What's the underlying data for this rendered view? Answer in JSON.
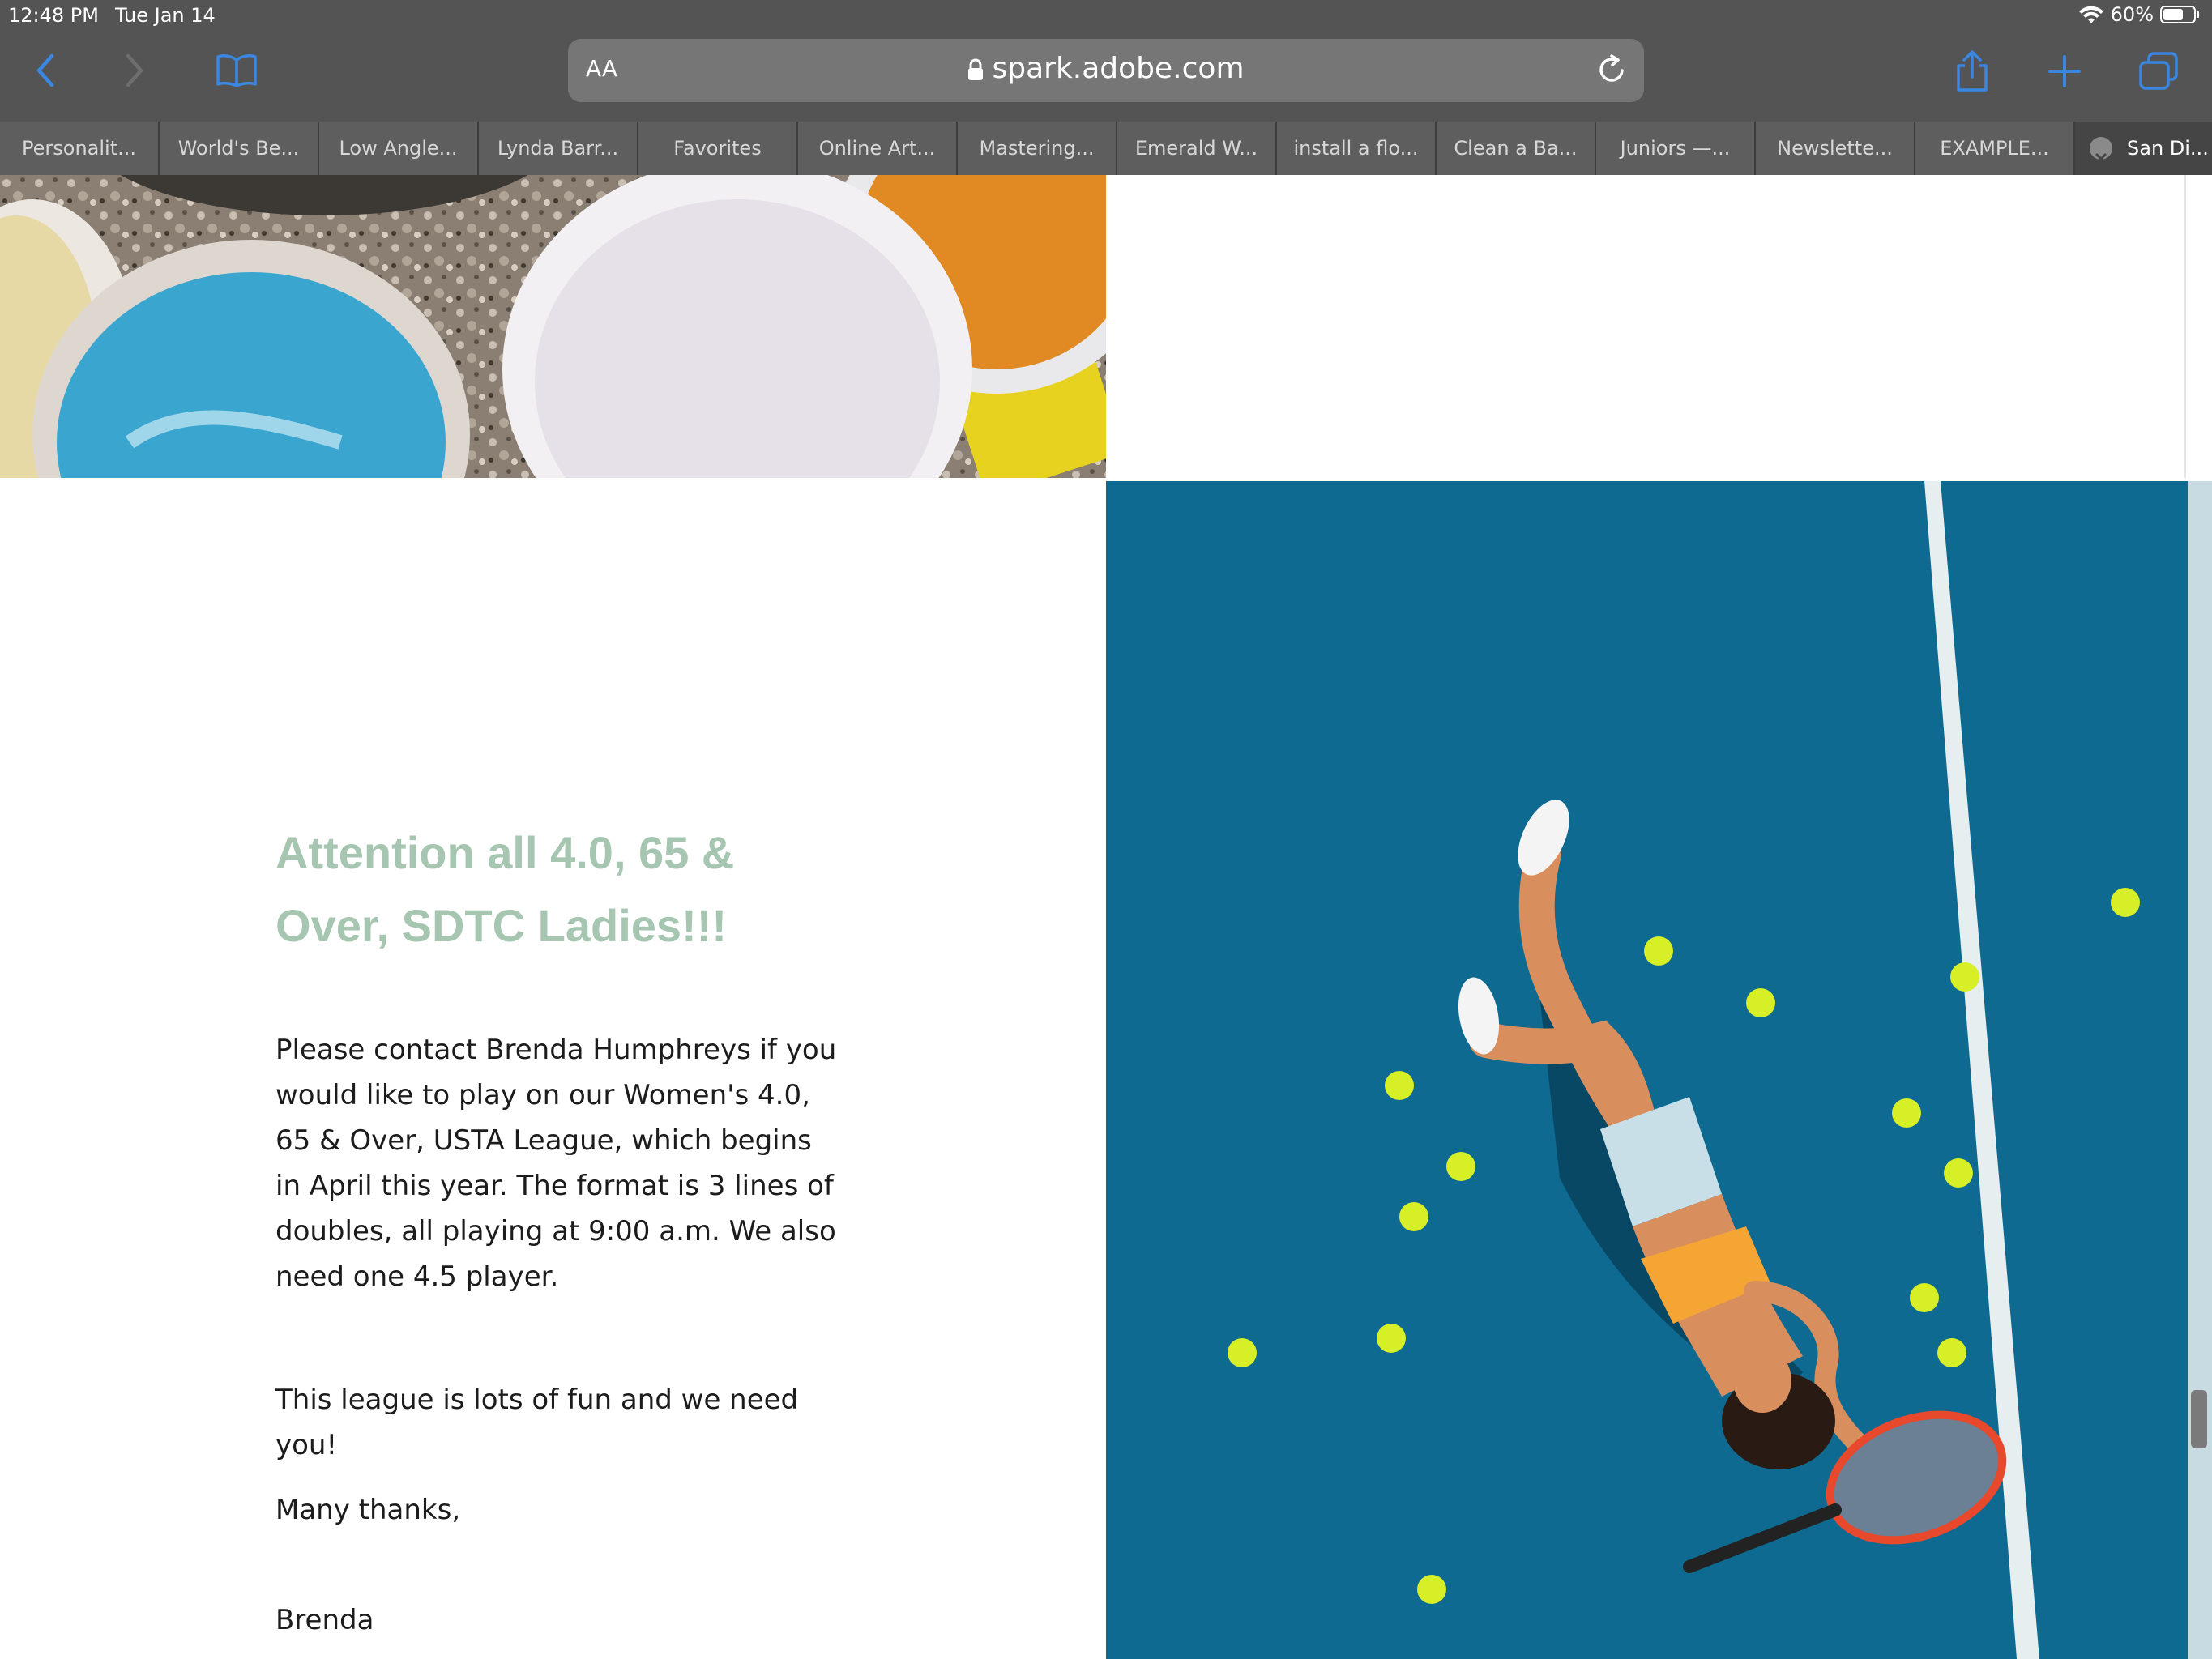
{
  "status_bar": {
    "time": "12:48 PM",
    "date": "Tue Jan 14",
    "battery": "60%"
  },
  "toolbar": {
    "text_size_label": "AA",
    "url": "spark.adobe.com"
  },
  "tabs": [
    {
      "label": "Personalit..."
    },
    {
      "label": "World's Be..."
    },
    {
      "label": "Low Angle..."
    },
    {
      "label": "Lynda Barr..."
    },
    {
      "label": "Favorites"
    },
    {
      "label": "Online Art..."
    },
    {
      "label": "Mastering..."
    },
    {
      "label": "Emerald W..."
    },
    {
      "label": "install a flo..."
    },
    {
      "label": "Clean a Ba..."
    },
    {
      "label": "Juniors —..."
    },
    {
      "label": "Newslette..."
    },
    {
      "label": "EXAMPLE..."
    },
    {
      "label": "San Di..."
    }
  ],
  "article": {
    "headline": "Attention all 4.0, 65  & Over, SDTC Ladies!!!",
    "paragraph1": "Please contact Brenda Humphreys if you would like to play on our Women's 4.0, 65  & Over, USTA League, which begins in April this year. The format is 3 lines of doubles, all playing at 9:00 a.m. We also need one 4.5 player.",
    "paragraph2": "This league is lots of fun and we need you!",
    "closing": "Many thanks,",
    "signature": "Brenda"
  },
  "colors": {
    "chrome": "#545454",
    "address_bar": "#767676",
    "accent_blue": "#3a86e0",
    "headline": "#a7c6b1",
    "court_blue": "#0e6a90"
  }
}
